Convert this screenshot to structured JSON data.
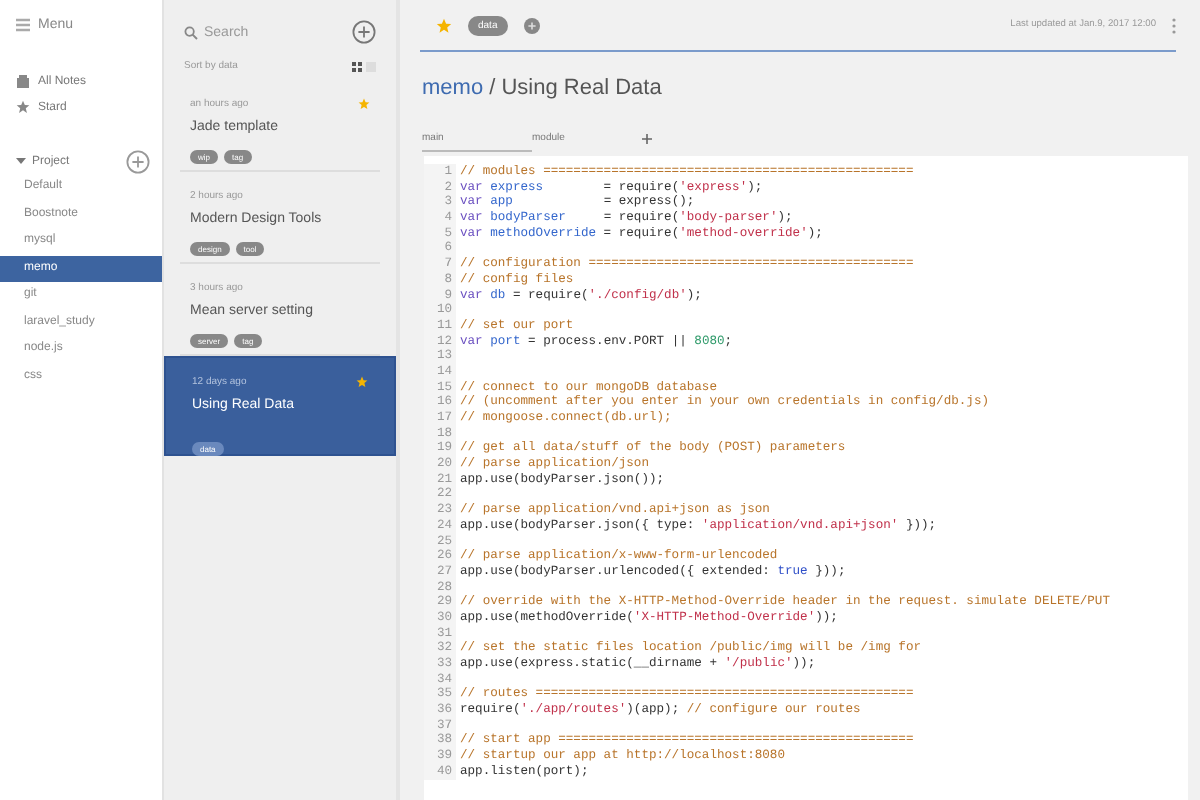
{
  "sidebar": {
    "menu_label": "Menu",
    "nav": [
      {
        "label": "All Notes",
        "kind": "notes"
      },
      {
        "label": "Stard",
        "kind": "star"
      }
    ],
    "folder": {
      "label": "Project",
      "expanded": true,
      "children": [
        {
          "label": "Default",
          "selected": false
        },
        {
          "label": "Boostnote",
          "selected": false
        },
        {
          "label": "mysql",
          "selected": false
        },
        {
          "label": "memo",
          "selected": true
        },
        {
          "label": "git",
          "selected": false
        },
        {
          "label": "laravel_study",
          "selected": false
        },
        {
          "label": "node.js",
          "selected": false
        },
        {
          "label": "css",
          "selected": false
        }
      ]
    }
  },
  "note_list": {
    "search": {
      "placeholder": "Search"
    },
    "sort_label": "Sort by data",
    "notes": [
      {
        "time": "an hours ago",
        "title": "Jade template",
        "starred": true,
        "selected": false,
        "tags": [
          "wip",
          "tag"
        ]
      },
      {
        "time": "2 hours ago",
        "title": "Modern Design Tools",
        "starred": false,
        "selected": false,
        "tags": [
          "design",
          "tool"
        ]
      },
      {
        "time": "3 hours ago",
        "title": "Mean server setting",
        "starred": false,
        "selected": false,
        "tags": [
          "server",
          "tag"
        ]
      },
      {
        "time": "12 days ago",
        "title": "Using Real Data",
        "starred": true,
        "selected": true,
        "tags": [
          "data"
        ]
      }
    ]
  },
  "editor": {
    "starred": true,
    "tags": [
      "data"
    ],
    "last_updated": "Last updated at  Jan.9, 2017 12:00",
    "breadcrumb": {
      "folder": "memo",
      "separator": "/",
      "title": "Using Real Data"
    },
    "tabs": [
      {
        "label": "main",
        "selected": true
      },
      {
        "label": "module",
        "selected": false
      }
    ],
    "code": {
      "lines": [
        {
          "number": "1",
          "tokens": [
            {
              "kind": "comment",
              "text": "// modules ================================================="
            }
          ]
        },
        {
          "number": "2",
          "tokens": [
            {
              "kind": "keyword",
              "text": "var "
            },
            {
              "kind": "name",
              "text": "express"
            },
            {
              "kind": "plain",
              "text": "        = require("
            },
            {
              "kind": "string",
              "text": "'express'"
            },
            {
              "kind": "plain",
              "text": ");"
            }
          ]
        },
        {
          "number": "3",
          "tokens": [
            {
              "kind": "keyword",
              "text": "var "
            },
            {
              "kind": "name",
              "text": "app"
            },
            {
              "kind": "plain",
              "text": "            = express();"
            }
          ]
        },
        {
          "number": "4",
          "tokens": [
            {
              "kind": "keyword",
              "text": "var "
            },
            {
              "kind": "name",
              "text": "bodyParser"
            },
            {
              "kind": "plain",
              "text": "     = require("
            },
            {
              "kind": "string",
              "text": "'body-parser'"
            },
            {
              "kind": "plain",
              "text": ");"
            }
          ]
        },
        {
          "number": "5",
          "tokens": [
            {
              "kind": "keyword",
              "text": "var "
            },
            {
              "kind": "name",
              "text": "methodOverride"
            },
            {
              "kind": "plain",
              "text": " = require("
            },
            {
              "kind": "string",
              "text": "'method-override'"
            },
            {
              "kind": "plain",
              "text": ");"
            }
          ]
        },
        {
          "number": "6"
        },
        {
          "number": "7",
          "tokens": [
            {
              "kind": "comment",
              "text": "// configuration ==========================================="
            }
          ]
        },
        {
          "number": "8",
          "tokens": [
            {
              "kind": "comment",
              "text": "// config files"
            }
          ]
        },
        {
          "number": "9",
          "tokens": [
            {
              "kind": "keyword",
              "text": "var "
            },
            {
              "kind": "name",
              "text": "db"
            },
            {
              "kind": "plain",
              "text": " = require("
            },
            {
              "kind": "string",
              "text": "'./config/db'"
            },
            {
              "kind": "plain",
              "text": ");"
            }
          ]
        },
        {
          "number": "10"
        },
        {
          "number": "11",
          "tokens": [
            {
              "kind": "comment",
              "text": "// set our port"
            }
          ]
        },
        {
          "number": "12",
          "tokens": [
            {
              "kind": "keyword",
              "text": "var "
            },
            {
              "kind": "name",
              "text": "port"
            },
            {
              "kind": "plain",
              "text": " = process.env.PORT || "
            },
            {
              "kind": "number",
              "text": "8080"
            },
            {
              "kind": "plain",
              "text": ";"
            }
          ]
        },
        {
          "number": "13"
        },
        {
          "number": "14"
        },
        {
          "number": "15",
          "tokens": [
            {
              "kind": "comment",
              "text": "// connect to our mongoDB database"
            }
          ]
        },
        {
          "number": "16",
          "tokens": [
            {
              "kind": "comment",
              "text": "// (uncomment after you enter in your own credentials in config/db.js)"
            }
          ]
        },
        {
          "number": "17",
          "tokens": [
            {
              "kind": "comment",
              "text": "// mongoose.connect(db.url);"
            }
          ]
        },
        {
          "number": "18"
        },
        {
          "number": "19",
          "tokens": [
            {
              "kind": "comment",
              "text": "// get all data/stuff of the body (POST) parameters"
            }
          ]
        },
        {
          "number": "20",
          "tokens": [
            {
              "kind": "comment",
              "text": "// parse application/json"
            }
          ]
        },
        {
          "number": "21",
          "tokens": [
            {
              "kind": "plain",
              "text": "app.use(bodyParser.json());"
            }
          ]
        },
        {
          "number": "22"
        },
        {
          "number": "23",
          "tokens": [
            {
              "kind": "comment",
              "text": "// parse application/vnd.api+json as json"
            }
          ]
        },
        {
          "number": "24",
          "tokens": [
            {
              "kind": "plain",
              "text": "app.use(bodyParser.json({ type: "
            },
            {
              "kind": "string",
              "text": "'application/vnd.api+json'"
            },
            {
              "kind": "plain",
              "text": " }));"
            }
          ]
        },
        {
          "number": "25"
        },
        {
          "number": "26",
          "tokens": [
            {
              "kind": "comment",
              "text": "// parse application/x-www-form-urlencoded"
            }
          ]
        },
        {
          "number": "27",
          "tokens": [
            {
              "kind": "plain",
              "text": "app.use(bodyParser.urlencoded({ extended: "
            },
            {
              "kind": "bool",
              "text": "true"
            },
            {
              "kind": "plain",
              "text": " }));"
            }
          ]
        },
        {
          "number": "28"
        },
        {
          "number": "29",
          "tokens": [
            {
              "kind": "comment",
              "text": "// override with the X-HTTP-Method-Override header in the request. simulate DELETE/PUT"
            }
          ]
        },
        {
          "number": "30",
          "tokens": [
            {
              "kind": "plain",
              "text": "app.use(methodOverride("
            },
            {
              "kind": "string",
              "text": "'X-HTTP-Method-Override'"
            },
            {
              "kind": "plain",
              "text": "));"
            }
          ]
        },
        {
          "number": "31"
        },
        {
          "number": "32",
          "tokens": [
            {
              "kind": "comment",
              "text": "// set the static files location /public/img will be /img for"
            }
          ]
        },
        {
          "number": "33",
          "tokens": [
            {
              "kind": "plain",
              "text": "app.use(express.static(__dirname + "
            },
            {
              "kind": "string",
              "text": "'/public'"
            },
            {
              "kind": "plain",
              "text": "));"
            }
          ]
        },
        {
          "number": "34"
        },
        {
          "number": "35",
          "tokens": [
            {
              "kind": "comment",
              "text": "// routes =================================================="
            }
          ]
        },
        {
          "number": "36",
          "tokens": [
            {
              "kind": "plain",
              "text": "require("
            },
            {
              "kind": "string",
              "text": "'./app/routes'"
            },
            {
              "kind": "plain",
              "text": ")(app); "
            },
            {
              "kind": "comment",
              "text": "// configure our routes"
            }
          ]
        },
        {
          "number": "37"
        },
        {
          "number": "38",
          "tokens": [
            {
              "kind": "comment",
              "text": "// start app ==============================================="
            }
          ]
        },
        {
          "number": "39",
          "tokens": [
            {
              "kind": "comment",
              "text": "// startup our app at http://localhost:8080"
            }
          ]
        },
        {
          "number": "40",
          "tokens": [
            {
              "kind": "plain",
              "text": "app.listen(port);"
            }
          ]
        }
      ]
    }
  }
}
